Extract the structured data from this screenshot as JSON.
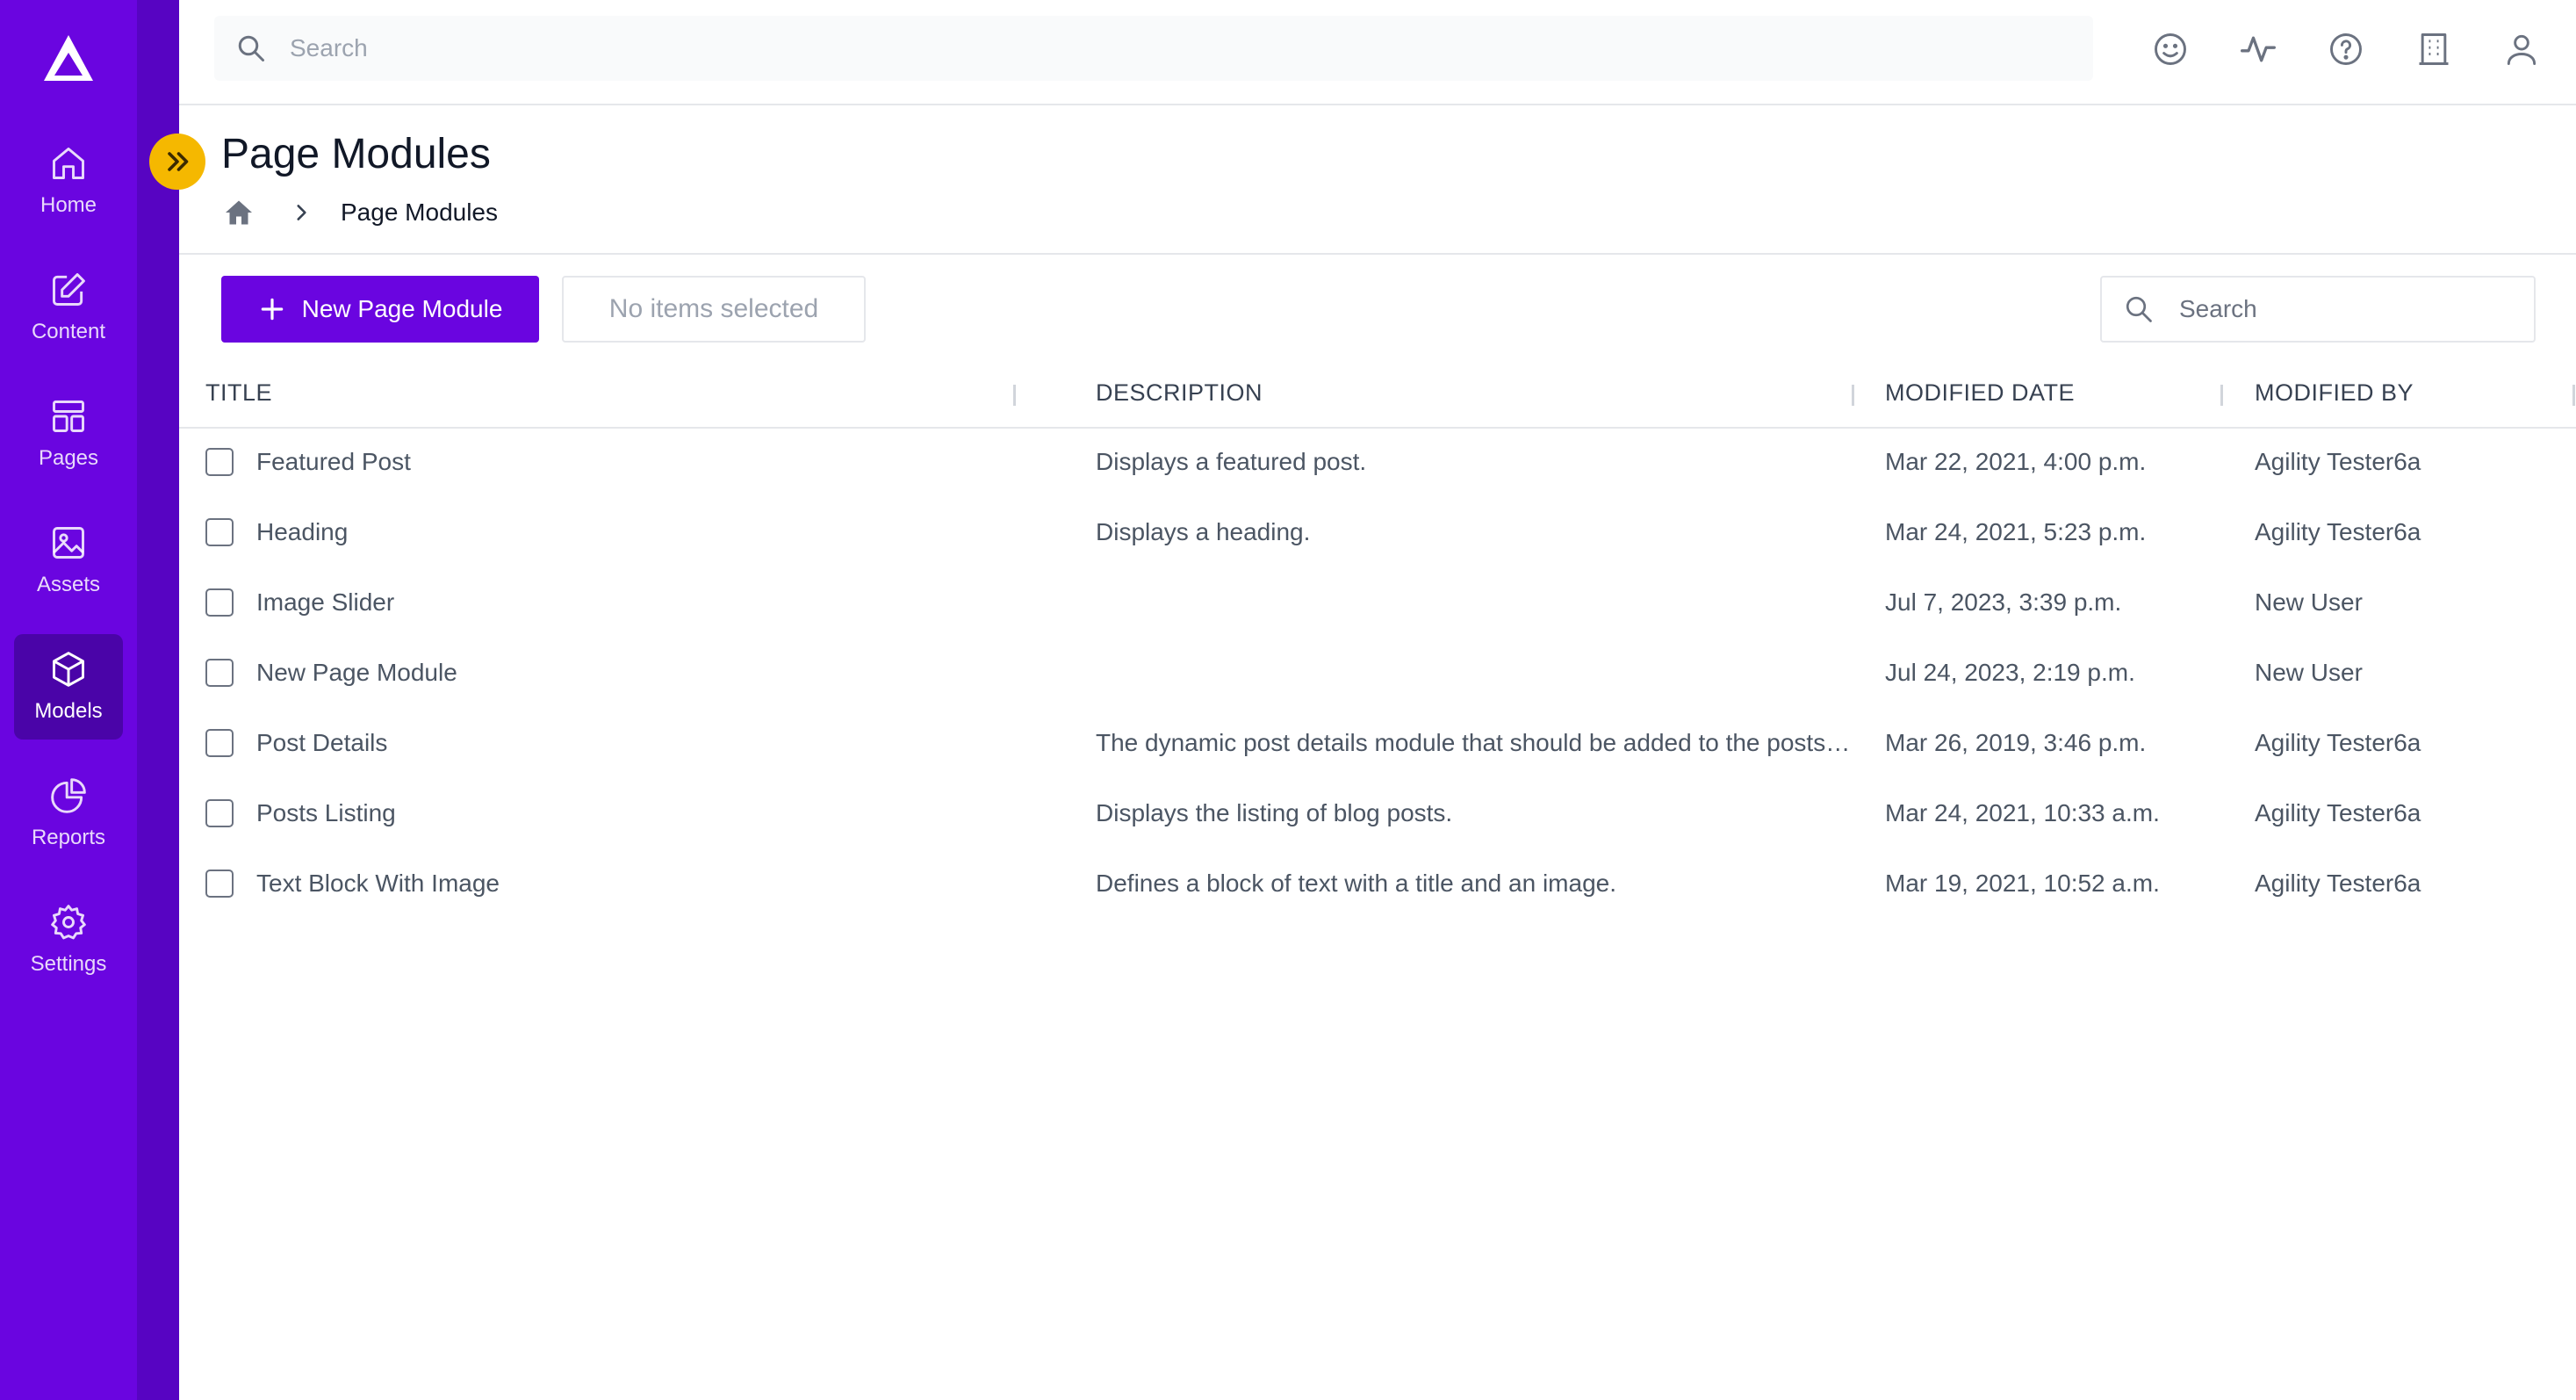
{
  "sidebar": {
    "items": [
      {
        "label": "Home",
        "active": false
      },
      {
        "label": "Content",
        "active": false
      },
      {
        "label": "Pages",
        "active": false
      },
      {
        "label": "Assets",
        "active": false
      },
      {
        "label": "Models",
        "active": true
      },
      {
        "label": "Reports",
        "active": false
      },
      {
        "label": "Settings",
        "active": false
      }
    ]
  },
  "topbar": {
    "search_placeholder": "Search",
    "icons": [
      "smiley-icon",
      "activity-icon",
      "help-icon",
      "building-icon",
      "user-icon"
    ]
  },
  "page": {
    "title": "Page Modules",
    "breadcrumb": [
      "Page Modules"
    ]
  },
  "toolbar": {
    "new_label": "New Page Module",
    "selection_label": "No items selected",
    "search_placeholder": "Search"
  },
  "table": {
    "columns": [
      "TITLE",
      "DESCRIPTION",
      "MODIFIED DATE",
      "MODIFIED BY"
    ],
    "rows": [
      {
        "title": "Featured Post",
        "description": "Displays a featured post.",
        "date": "Mar 22, 2021, 4:00 p.m.",
        "user": "Agility Tester6a"
      },
      {
        "title": "Heading",
        "description": "Displays a heading.",
        "date": "Mar 24, 2021, 5:23 p.m.",
        "user": "Agility Tester6a"
      },
      {
        "title": "Image Slider",
        "description": "",
        "date": "Jul 7, 2023, 3:39 p.m.",
        "user": "New User"
      },
      {
        "title": "New Page Module",
        "description": "",
        "date": "Jul 24, 2023, 2:19 p.m.",
        "user": "New User"
      },
      {
        "title": "Post Details",
        "description": "The dynamic post details module that should be added to the posts…",
        "date": "Mar 26, 2019, 3:46 p.m.",
        "user": "Agility Tester6a"
      },
      {
        "title": "Posts Listing",
        "description": "Displays the listing of blog posts.",
        "date": "Mar 24, 2021, 10:33 a.m.",
        "user": "Agility Tester6a"
      },
      {
        "title": "Text Block With Image",
        "description": "Defines a block of text with a title and an image.",
        "date": "Mar 19, 2021, 10:52 a.m.",
        "user": "Agility Tester6a"
      }
    ]
  },
  "colors": {
    "brand": "#6a05e0",
    "accent": "#f5b800"
  }
}
